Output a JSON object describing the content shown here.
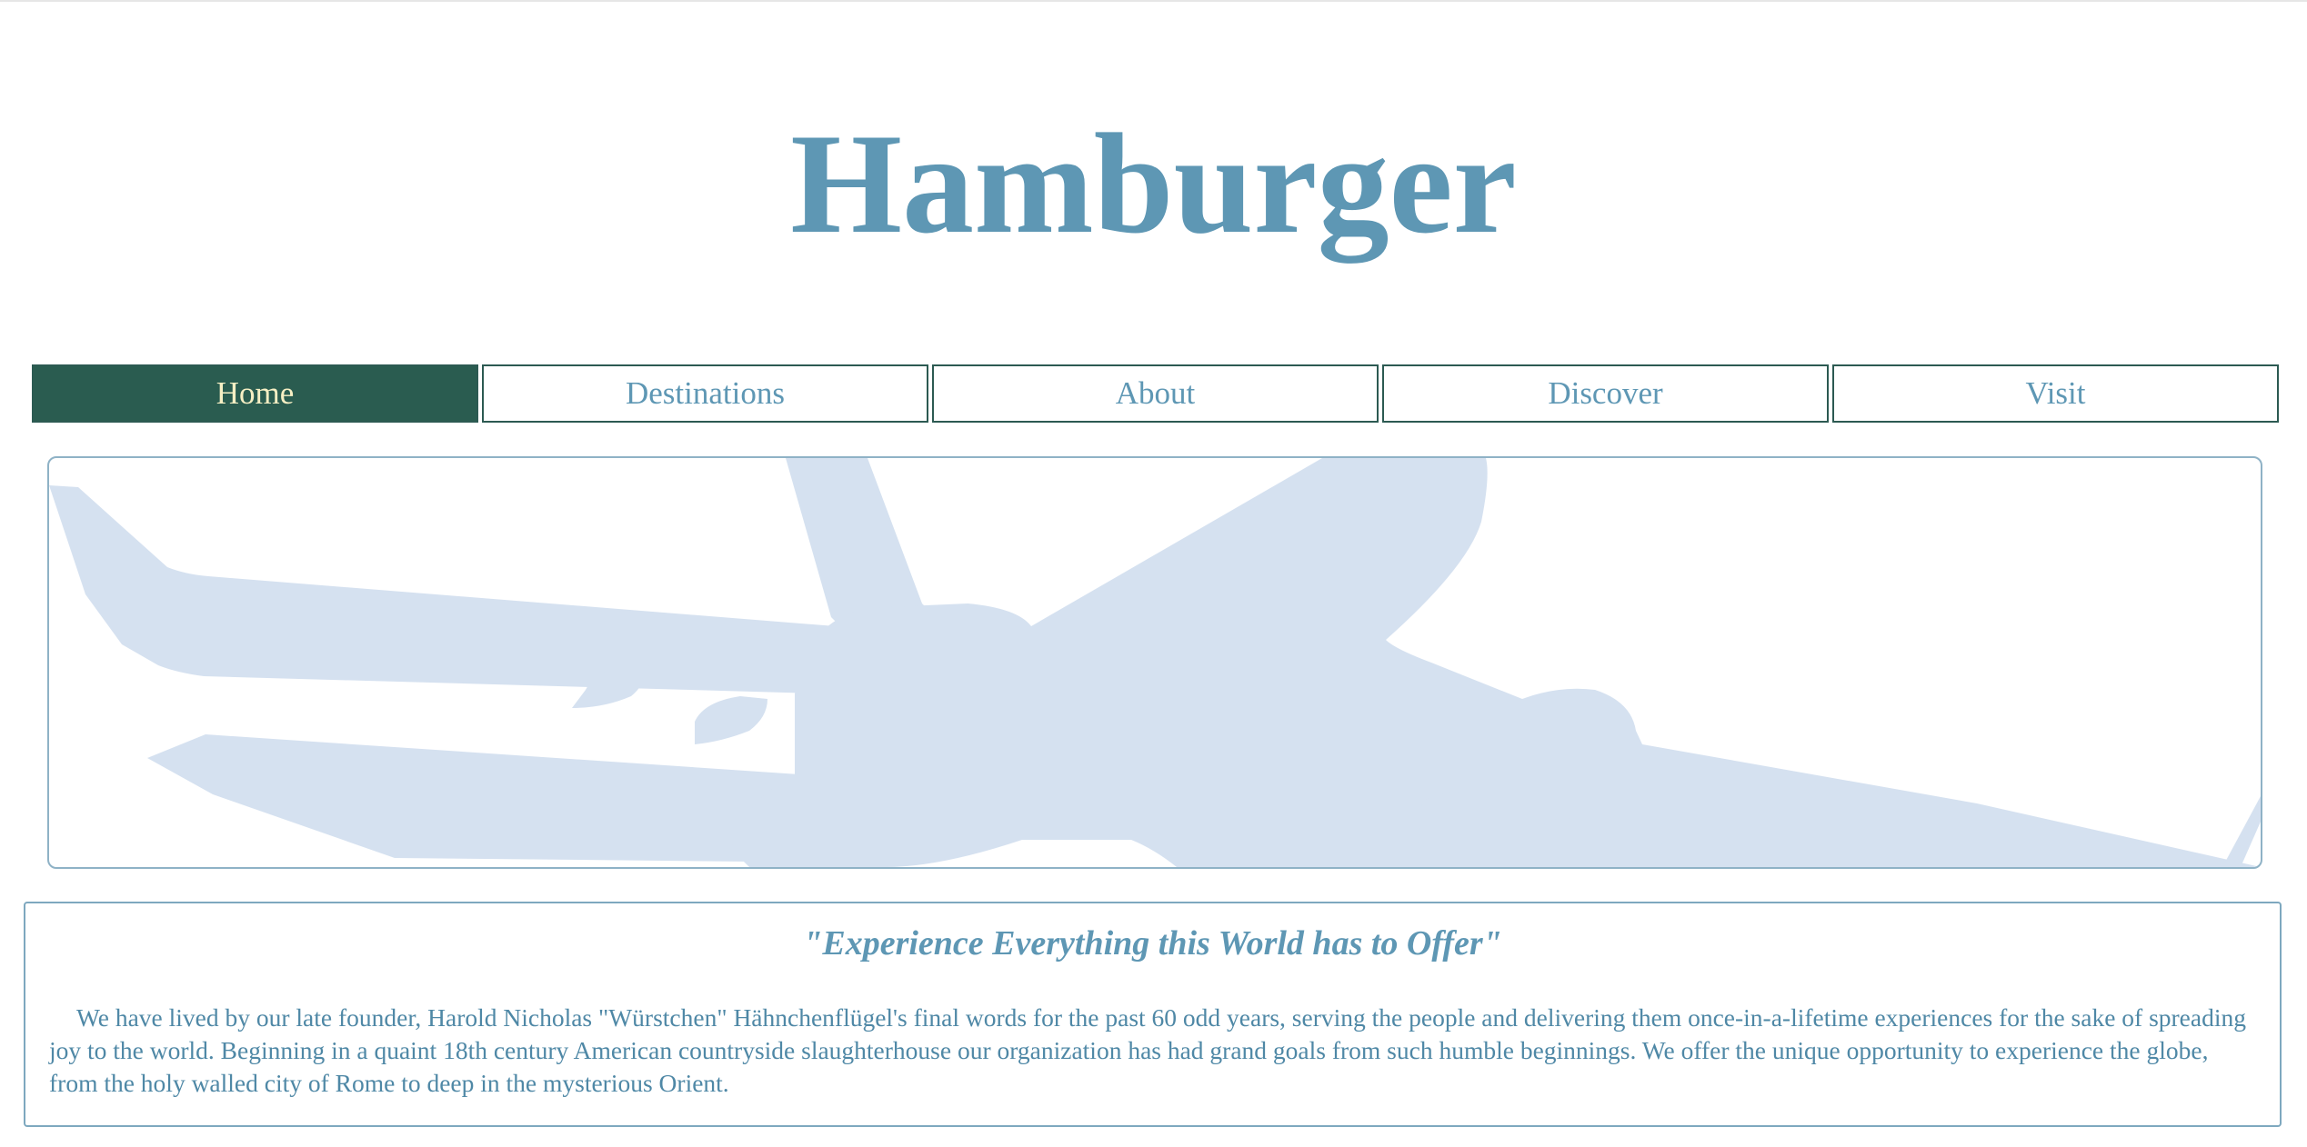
{
  "header": {
    "title": "Hamburger"
  },
  "nav": {
    "items": [
      {
        "label": "Home",
        "active": true
      },
      {
        "label": "Destinations",
        "active": false
      },
      {
        "label": "About",
        "active": false
      },
      {
        "label": "Discover",
        "active": false
      },
      {
        "label": "Visit",
        "active": false
      }
    ]
  },
  "hero": {
    "image_subject": "airplane-silhouette",
    "silhouette_color": "#d5e1f0"
  },
  "about": {
    "tagline": "\"Experience Everything this World has to Offer\"",
    "body": "We have lived by our late founder, Harold Nicholas \"Würstchen\" Hähnchenflügel's final words for the past 60 odd years, serving the people and delivering them once-in-a-lifetime experiences for the sake of spreading joy to the world. Beginning in a quaint 18th century American countryside slaughterhouse our organization has had grand goals from such humble beginnings. We offer the unique opportunity to experience the globe, from the holy walled city of Rome to deep in the mysterious Orient."
  },
  "colors": {
    "accent": "#5e97b4",
    "nav_active_bg": "#2a5c50",
    "nav_active_text": "#f6efc4",
    "nav_border": "#2c5a52"
  }
}
